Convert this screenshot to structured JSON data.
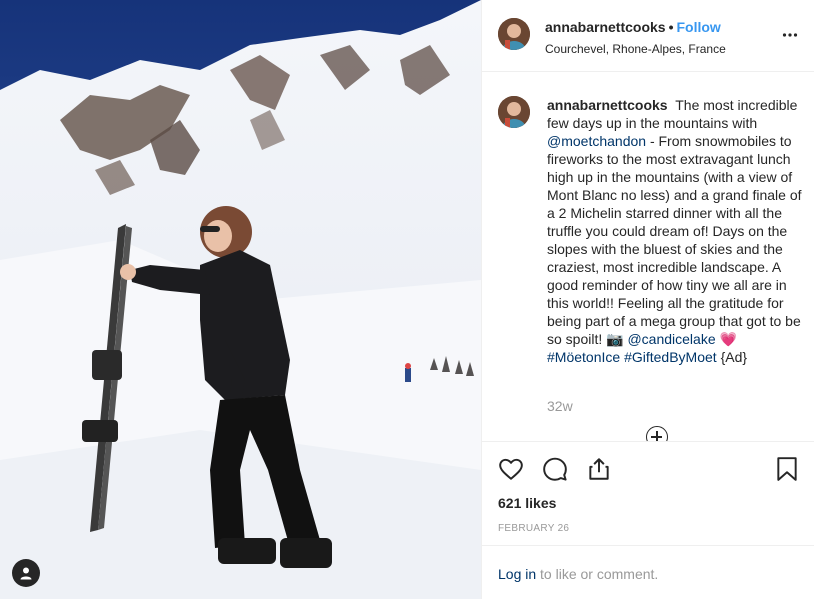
{
  "post": {
    "username": "annabarnettcooks",
    "dot": "•",
    "follow_label": "Follow",
    "location": "Courchevel, Rhone-Alpes, France"
  },
  "caption": {
    "username": "annabarnettcooks",
    "text1": "The most incredible few days up in the mountains with",
    "mention1": "@moetchandon",
    "text2": "- From snowmobiles to fireworks to the most extravagant lunch high up in the mountains (with a view of Mont Blanc no less) and a grand finale of a 2 Michelin starred dinner with all the truffle you could dream of! Days on the slopes with the bluest of skies and the craziest, most incredible landscape. A good reminder of how tiny we all are in this world!! Feeling all the gratitude for being part of a mega group that got to be so spoilt! 📷",
    "mention2": "@candicelake",
    "heart": "💗",
    "hashtag1": "#MöetonIce",
    "hashtag2": "#GiftedByMoet",
    "text3": "{Ad}"
  },
  "timestamp": "32w",
  "likes": "621 likes",
  "date": "FEBRUARY 26",
  "login": {
    "link": "Log in",
    "text": "to like or comment."
  },
  "icons": {
    "more": "more-options-icon",
    "like": "heart-icon",
    "comment": "comment-icon",
    "share": "share-icon",
    "save": "bookmark-icon",
    "tag": "user-tag-icon",
    "load_more": "plus-circle-icon"
  },
  "colors": {
    "link": "#003569",
    "follow": "#3897f0",
    "muted": "#999999",
    "sky": "#1f3f86"
  }
}
